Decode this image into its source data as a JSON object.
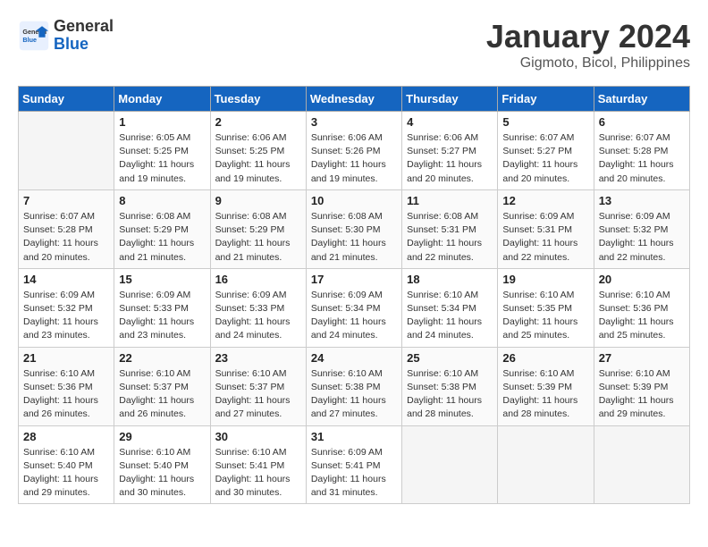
{
  "header": {
    "logo_general": "General",
    "logo_blue": "Blue",
    "month_title": "January 2024",
    "location": "Gigmoto, Bicol, Philippines"
  },
  "columns": [
    "Sunday",
    "Monday",
    "Tuesday",
    "Wednesday",
    "Thursday",
    "Friday",
    "Saturday"
  ],
  "weeks": [
    [
      {
        "day": "",
        "empty": true
      },
      {
        "day": "1",
        "sunrise": "Sunrise: 6:05 AM",
        "sunset": "Sunset: 5:25 PM",
        "daylight": "Daylight: 11 hours and 19 minutes."
      },
      {
        "day": "2",
        "sunrise": "Sunrise: 6:06 AM",
        "sunset": "Sunset: 5:25 PM",
        "daylight": "Daylight: 11 hours and 19 minutes."
      },
      {
        "day": "3",
        "sunrise": "Sunrise: 6:06 AM",
        "sunset": "Sunset: 5:26 PM",
        "daylight": "Daylight: 11 hours and 19 minutes."
      },
      {
        "day": "4",
        "sunrise": "Sunrise: 6:06 AM",
        "sunset": "Sunset: 5:27 PM",
        "daylight": "Daylight: 11 hours and 20 minutes."
      },
      {
        "day": "5",
        "sunrise": "Sunrise: 6:07 AM",
        "sunset": "Sunset: 5:27 PM",
        "daylight": "Daylight: 11 hours and 20 minutes."
      },
      {
        "day": "6",
        "sunrise": "Sunrise: 6:07 AM",
        "sunset": "Sunset: 5:28 PM",
        "daylight": "Daylight: 11 hours and 20 minutes."
      }
    ],
    [
      {
        "day": "7",
        "sunrise": "Sunrise: 6:07 AM",
        "sunset": "Sunset: 5:28 PM",
        "daylight": "Daylight: 11 hours and 20 minutes."
      },
      {
        "day": "8",
        "sunrise": "Sunrise: 6:08 AM",
        "sunset": "Sunset: 5:29 PM",
        "daylight": "Daylight: 11 hours and 21 minutes."
      },
      {
        "day": "9",
        "sunrise": "Sunrise: 6:08 AM",
        "sunset": "Sunset: 5:29 PM",
        "daylight": "Daylight: 11 hours and 21 minutes."
      },
      {
        "day": "10",
        "sunrise": "Sunrise: 6:08 AM",
        "sunset": "Sunset: 5:30 PM",
        "daylight": "Daylight: 11 hours and 21 minutes."
      },
      {
        "day": "11",
        "sunrise": "Sunrise: 6:08 AM",
        "sunset": "Sunset: 5:31 PM",
        "daylight": "Daylight: 11 hours and 22 minutes."
      },
      {
        "day": "12",
        "sunrise": "Sunrise: 6:09 AM",
        "sunset": "Sunset: 5:31 PM",
        "daylight": "Daylight: 11 hours and 22 minutes."
      },
      {
        "day": "13",
        "sunrise": "Sunrise: 6:09 AM",
        "sunset": "Sunset: 5:32 PM",
        "daylight": "Daylight: 11 hours and 22 minutes."
      }
    ],
    [
      {
        "day": "14",
        "sunrise": "Sunrise: 6:09 AM",
        "sunset": "Sunset: 5:32 PM",
        "daylight": "Daylight: 11 hours and 23 minutes."
      },
      {
        "day": "15",
        "sunrise": "Sunrise: 6:09 AM",
        "sunset": "Sunset: 5:33 PM",
        "daylight": "Daylight: 11 hours and 23 minutes."
      },
      {
        "day": "16",
        "sunrise": "Sunrise: 6:09 AM",
        "sunset": "Sunset: 5:33 PM",
        "daylight": "Daylight: 11 hours and 24 minutes."
      },
      {
        "day": "17",
        "sunrise": "Sunrise: 6:09 AM",
        "sunset": "Sunset: 5:34 PM",
        "daylight": "Daylight: 11 hours and 24 minutes."
      },
      {
        "day": "18",
        "sunrise": "Sunrise: 6:10 AM",
        "sunset": "Sunset: 5:34 PM",
        "daylight": "Daylight: 11 hours and 24 minutes."
      },
      {
        "day": "19",
        "sunrise": "Sunrise: 6:10 AM",
        "sunset": "Sunset: 5:35 PM",
        "daylight": "Daylight: 11 hours and 25 minutes."
      },
      {
        "day": "20",
        "sunrise": "Sunrise: 6:10 AM",
        "sunset": "Sunset: 5:36 PM",
        "daylight": "Daylight: 11 hours and 25 minutes."
      }
    ],
    [
      {
        "day": "21",
        "sunrise": "Sunrise: 6:10 AM",
        "sunset": "Sunset: 5:36 PM",
        "daylight": "Daylight: 11 hours and 26 minutes."
      },
      {
        "day": "22",
        "sunrise": "Sunrise: 6:10 AM",
        "sunset": "Sunset: 5:37 PM",
        "daylight": "Daylight: 11 hours and 26 minutes."
      },
      {
        "day": "23",
        "sunrise": "Sunrise: 6:10 AM",
        "sunset": "Sunset: 5:37 PM",
        "daylight": "Daylight: 11 hours and 27 minutes."
      },
      {
        "day": "24",
        "sunrise": "Sunrise: 6:10 AM",
        "sunset": "Sunset: 5:38 PM",
        "daylight": "Daylight: 11 hours and 27 minutes."
      },
      {
        "day": "25",
        "sunrise": "Sunrise: 6:10 AM",
        "sunset": "Sunset: 5:38 PM",
        "daylight": "Daylight: 11 hours and 28 minutes."
      },
      {
        "day": "26",
        "sunrise": "Sunrise: 6:10 AM",
        "sunset": "Sunset: 5:39 PM",
        "daylight": "Daylight: 11 hours and 28 minutes."
      },
      {
        "day": "27",
        "sunrise": "Sunrise: 6:10 AM",
        "sunset": "Sunset: 5:39 PM",
        "daylight": "Daylight: 11 hours and 29 minutes."
      }
    ],
    [
      {
        "day": "28",
        "sunrise": "Sunrise: 6:10 AM",
        "sunset": "Sunset: 5:40 PM",
        "daylight": "Daylight: 11 hours and 29 minutes."
      },
      {
        "day": "29",
        "sunrise": "Sunrise: 6:10 AM",
        "sunset": "Sunset: 5:40 PM",
        "daylight": "Daylight: 11 hours and 30 minutes."
      },
      {
        "day": "30",
        "sunrise": "Sunrise: 6:10 AM",
        "sunset": "Sunset: 5:41 PM",
        "daylight": "Daylight: 11 hours and 30 minutes."
      },
      {
        "day": "31",
        "sunrise": "Sunrise: 6:09 AM",
        "sunset": "Sunset: 5:41 PM",
        "daylight": "Daylight: 11 hours and 31 minutes."
      },
      {
        "day": "",
        "empty": true
      },
      {
        "day": "",
        "empty": true
      },
      {
        "day": "",
        "empty": true
      }
    ]
  ]
}
